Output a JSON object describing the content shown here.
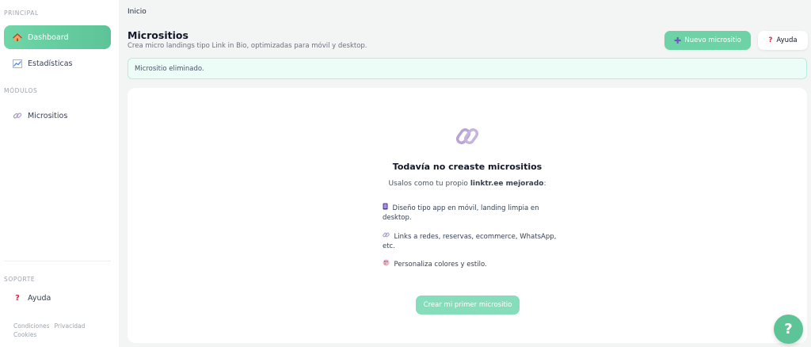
{
  "sidebar": {
    "section_principal": "PRINCIPAL",
    "section_modulos": "MÓDULOS",
    "section_soporte": "SOPORTE",
    "items": [
      {
        "label": "Dashboard",
        "icon": "home-icon"
      },
      {
        "label": "Estadísticas",
        "icon": "chart-icon"
      },
      {
        "label": "Micrositios",
        "icon": "link-icon"
      },
      {
        "label": "Ayuda",
        "icon": "question-icon"
      }
    ],
    "footer_links": [
      "Condiciones",
      "Privacidad",
      "Cookies"
    ]
  },
  "header": {
    "breadcrumb": "Inicio",
    "title": "Micrositios",
    "subtitle": "Crea micro landings tipo Link in Bio, optimizadas para móvil y desktop.",
    "new_button": "Nuevo micrositio",
    "help_button": "Ayuda"
  },
  "alert": {
    "text": "Micrositio eliminado."
  },
  "empty_state": {
    "title": "Todavía no creaste micrositios",
    "subtitle_prefix": "Usalos como tu propio ",
    "subtitle_bold": "linktr.ee mejorado",
    "subtitle_suffix": ":",
    "features": [
      {
        "icon": "phone-icon",
        "text": "Diseño tipo app en móvil, landing limpia en desktop."
      },
      {
        "icon": "link-icon",
        "text": "Links a redes, reservas, ecommerce, WhatsApp, etc."
      },
      {
        "icon": "palette-icon",
        "text": "Personaliza colores y estilo."
      }
    ],
    "cta": "Crear mi primer micrositio"
  },
  "fab": {
    "label": "?"
  },
  "colors": {
    "accent": "#6dd3a6",
    "alert_bg": "#ecfdf8",
    "help_red": "#e11d48"
  }
}
